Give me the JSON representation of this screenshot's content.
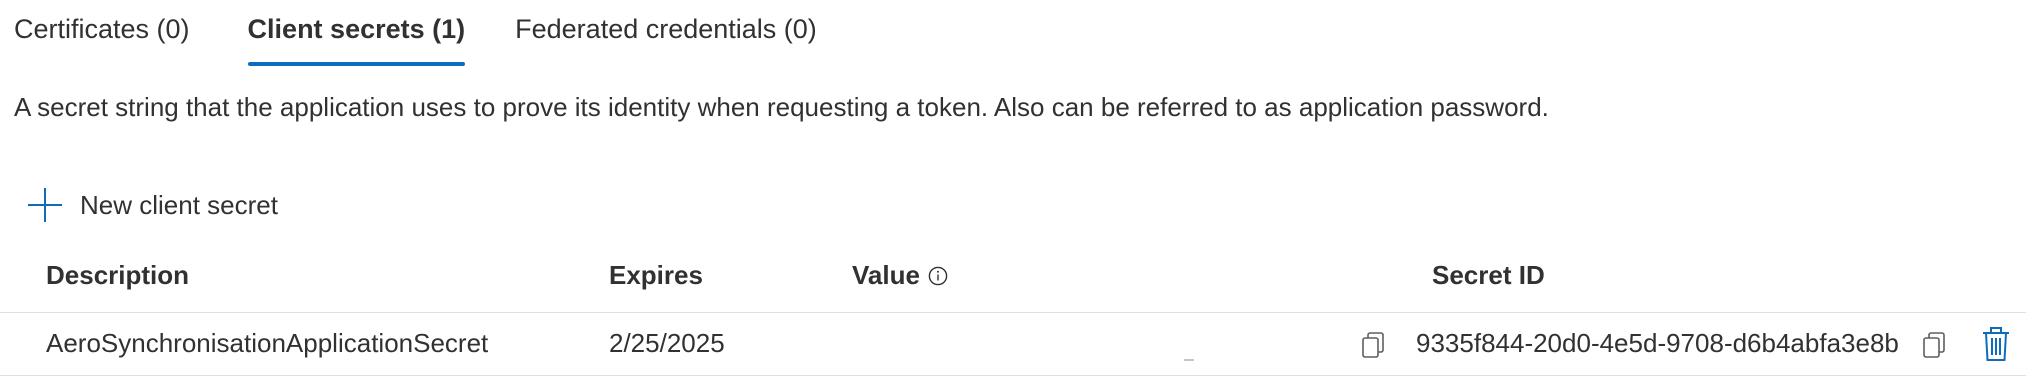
{
  "tabs": [
    {
      "label": "Certificates (0)",
      "active": false
    },
    {
      "label": "Client secrets (1)",
      "active": true
    },
    {
      "label": "Federated credentials (0)",
      "active": false
    }
  ],
  "description": "A secret string that the application uses to prove its identity when requesting a token. Also can be referred to as application password.",
  "new_secret": {
    "label": "New client secret",
    "icon": "plus-icon"
  },
  "table": {
    "headers": {
      "description": "Description",
      "expires": "Expires",
      "value": "Value",
      "secret_id": "Secret ID"
    },
    "rows": [
      {
        "description": "AeroSynchronisationApplicationSecret",
        "expires": "2/25/2025",
        "value": "",
        "secret_id": "9335f844-20d0-4e5d-9708-d6b4abfa3e8b"
      }
    ]
  },
  "icons": {
    "info": "info-icon",
    "copy": "copy-icon",
    "delete": "trash-icon"
  },
  "colors": {
    "accent": "#0f6cbd",
    "delete": "#0f6cbd",
    "text": "#323130",
    "divider": "#e1dfdd"
  }
}
